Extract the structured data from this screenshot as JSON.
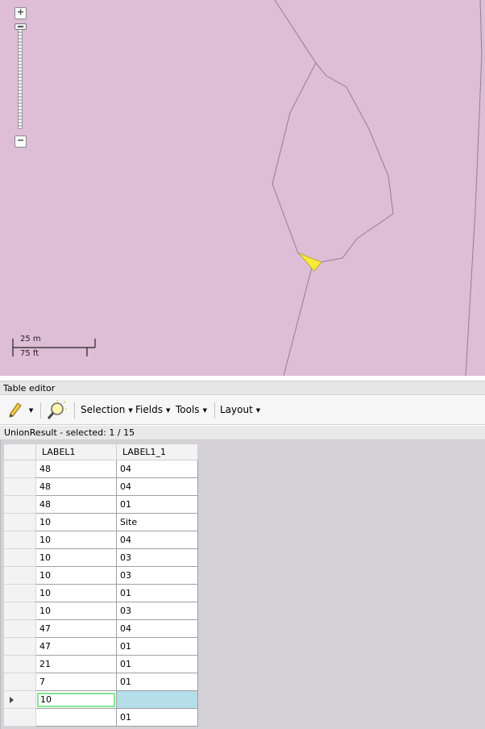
{
  "map": {
    "zoom_in_label": "+",
    "zoom_out_label": "−",
    "scale_metric": "25 m",
    "scale_imperial": "75 ft",
    "fill_color": "#debdd6",
    "highlight_color": "#f8ea3a"
  },
  "editor": {
    "title": "Table editor",
    "toolbar": {
      "edit_icon": "pencil-icon",
      "query_icon": "magnifier-icon",
      "selection_label": "Selection",
      "fields_label": "Fields",
      "tools_label": "Tools",
      "layout_label": "Layout"
    },
    "status": "UnionResult - selected: 1 / 15",
    "columns": [
      "LABEL1",
      "LABEL1_1"
    ],
    "rows": [
      [
        "48",
        "04"
      ],
      [
        "48",
        "04"
      ],
      [
        "48",
        "01"
      ],
      [
        "10",
        "Site"
      ],
      [
        "10",
        "04"
      ],
      [
        "10",
        "03"
      ],
      [
        "10",
        "03"
      ],
      [
        "10",
        "01"
      ],
      [
        "10",
        "03"
      ],
      [
        "47",
        "04"
      ],
      [
        "47",
        "01"
      ],
      [
        "21",
        "01"
      ],
      [
        "7",
        "01"
      ],
      [
        "10",
        ""
      ],
      [
        "",
        "01"
      ]
    ],
    "selected_row_index": 13,
    "selection_color": "#b5ddea"
  }
}
